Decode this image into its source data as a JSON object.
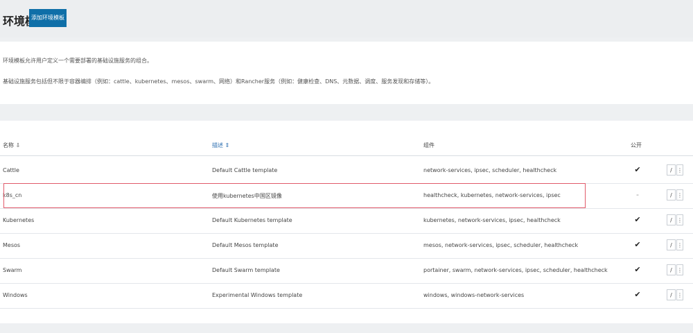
{
  "header": {
    "title": "环境模板",
    "add_button": "添加环境模板"
  },
  "description": {
    "line1": "环境模板允许用户定义一个需要部署的基础设施服务的组合。",
    "line2": "基础设施服务包括但不限于容器编排（例如：cattle、kubernetes、mesos、swarm、网络）和Rancher服务（例如：健康检查、DNS、元数据、调度、服务发现和存储等）。"
  },
  "table": {
    "columns": {
      "name": "名称 ⇩",
      "description": "描述 ⇕",
      "stacks": "组件",
      "public": "公开"
    },
    "rows": [
      {
        "name": "Cattle",
        "description": "Default Cattle template",
        "stacks": "network-services, ipsec, scheduler, healthcheck",
        "public": "✔",
        "edit": "/",
        "more": "⋮"
      },
      {
        "name": "k8s_cn",
        "description": "使用kubernetes中国区镜像",
        "stacks": "healthcheck, kubernetes, network-services, ipsec",
        "public": "-",
        "edit": "/",
        "more": "⋮"
      },
      {
        "name": "Kubernetes",
        "description": "Default Kubernetes template",
        "stacks": "kubernetes, network-services, ipsec, healthcheck",
        "public": "✔",
        "edit": "/",
        "more": "⋮"
      },
      {
        "name": "Mesos",
        "description": "Default Mesos template",
        "stacks": "mesos, network-services, ipsec, scheduler, healthcheck",
        "public": "✔",
        "edit": "/",
        "more": "⋮"
      },
      {
        "name": "Swarm",
        "description": "Default Swarm template",
        "stacks": "portainer, swarm, network-services, ipsec, scheduler, healthcheck",
        "public": "✔",
        "edit": "/",
        "more": "⋮"
      },
      {
        "name": "Windows",
        "description": "Experimental Windows template",
        "stacks": "windows, windows-network-services",
        "public": "✔",
        "edit": "/",
        "more": "⋮"
      }
    ]
  },
  "colors": {
    "accent": "#0f6fa8",
    "highlight": "#e05a6a",
    "background": "#eef0f2"
  }
}
